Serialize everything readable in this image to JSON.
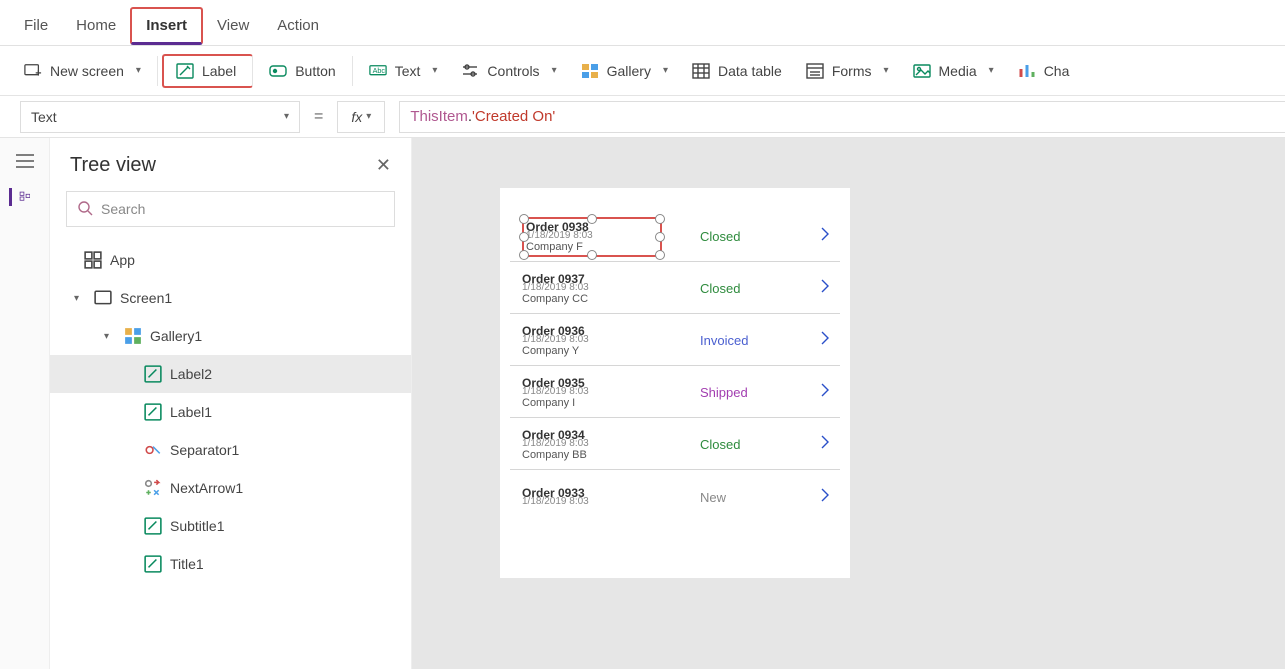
{
  "menu": {
    "items": [
      "File",
      "Home",
      "Insert",
      "View",
      "Action"
    ],
    "active": "Insert"
  },
  "ribbon": {
    "new_screen": "New screen",
    "label": "Label",
    "button": "Button",
    "text": "Text",
    "controls": "Controls",
    "gallery": "Gallery",
    "data_table": "Data table",
    "forms": "Forms",
    "media": "Media",
    "charts": "Cha"
  },
  "formula": {
    "property": "Text",
    "fx": "fx",
    "token_this": "ThisItem",
    "token_dot": ".",
    "token_prop": "'Created On'"
  },
  "tree": {
    "title": "Tree view",
    "search_placeholder": "Search",
    "nodes": {
      "app": "App",
      "screen1": "Screen1",
      "gallery1": "Gallery1",
      "label2": "Label2",
      "label1": "Label1",
      "separator1": "Separator1",
      "nextarrow1": "NextArrow1",
      "subtitle1": "Subtitle1",
      "title1": "Title1"
    },
    "selected": "Label2"
  },
  "gallery_data": [
    {
      "title": "Order 0938",
      "company": "Company F",
      "date": "1/18/2019 8:03",
      "status": "Closed",
      "status_class": "st-closed",
      "selected": true
    },
    {
      "title": "Order 0937",
      "company": "Company CC",
      "date": "1/18/2019 8:03",
      "status": "Closed",
      "status_class": "st-closed"
    },
    {
      "title": "Order 0936",
      "company": "Company Y",
      "date": "1/18/2019 8:03",
      "status": "Invoiced",
      "status_class": "st-invoiced"
    },
    {
      "title": "Order 0935",
      "company": "Company I",
      "date": "1/18/2019 8:03",
      "status": "Shipped",
      "status_class": "st-shipped"
    },
    {
      "title": "Order 0934",
      "company": "Company BB",
      "date": "1/18/2019 8:03",
      "status": "Closed",
      "status_class": "st-closed"
    },
    {
      "title": "Order 0933",
      "company": "",
      "date": "1/18/2019 8:03",
      "status": "New",
      "status_class": "st-new"
    }
  ]
}
